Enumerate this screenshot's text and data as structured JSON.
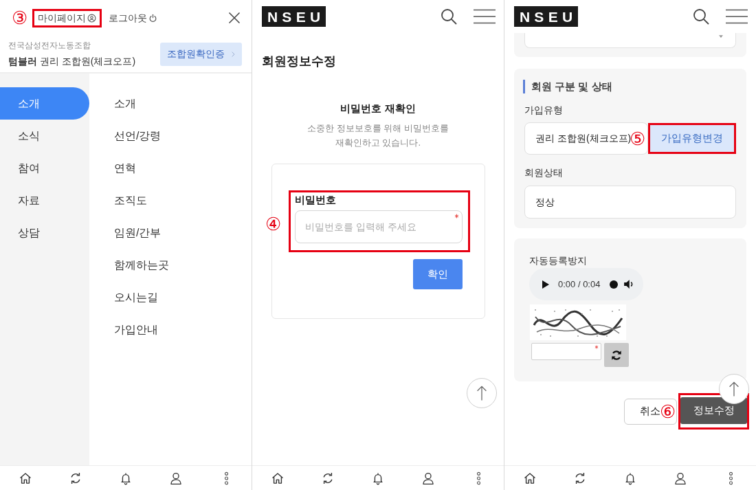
{
  "screens": [
    {
      "kind": "menu",
      "account_links": [
        {
          "kind": "mypage",
          "label": "마이페이지",
          "highlighted": true,
          "annotation": "③"
        },
        {
          "kind": "logout",
          "label": "로그아웃",
          "highlighted": false
        }
      ],
      "union_name": "전국삼성전자노동조합",
      "member_info": "**텀블러** 권리 조합원(체크오프)",
      "member_card_button": "조합원확인증",
      "categories": [
        {
          "label": "소개",
          "selected": true
        },
        {
          "label": "소식",
          "selected": false
        },
        {
          "label": "참여",
          "selected": false
        },
        {
          "label": "자료",
          "selected": false
        },
        {
          "label": "상담",
          "selected": false
        }
      ],
      "submenu": [
        "소개",
        "선언/강령",
        "연혁",
        "조직도",
        "임원/간부",
        "함께하는곳",
        "오시는길",
        "가입안내"
      ]
    },
    {
      "kind": "password_check",
      "logo": "NSEU",
      "title": "회원정보수정",
      "heading": "비밀번호 재확인",
      "description": "소중한 정보보호를 위해 비밀번호를\n재확인하고 있습니다.",
      "password_field": {
        "label": "비밀번호",
        "placeholder": "비밀번호를 입력해 주세요",
        "required": true,
        "highlighted": true,
        "annotation": "④"
      },
      "confirm_button": "확인",
      "scroll_top_button": true
    },
    {
      "kind": "member_form",
      "logo": "NSEU",
      "cut_off_fields": [
        {
          "kind": "select"
        }
      ],
      "section": {
        "title": "회원 구분 및 상태",
        "fields": [
          {
            "label": "가입유형",
            "value": "권리 조합원(체크오프)",
            "action": {
              "label": "가입유형변경",
              "highlighted": true,
              "annotation": "⑤"
            }
          },
          {
            "label": "회원상태",
            "value": "정상"
          }
        ]
      },
      "captcha": {
        "label": "자동등록방지",
        "audio_time": "0:00 / 0:04",
        "required": true
      },
      "actions": [
        {
          "kind": "secondary",
          "label": "취소",
          "highlighted": false
        },
        {
          "kind": "primary",
          "label": "정보수정",
          "highlighted": true,
          "annotation": "⑥"
        }
      ],
      "scroll_top_button": true
    }
  ]
}
